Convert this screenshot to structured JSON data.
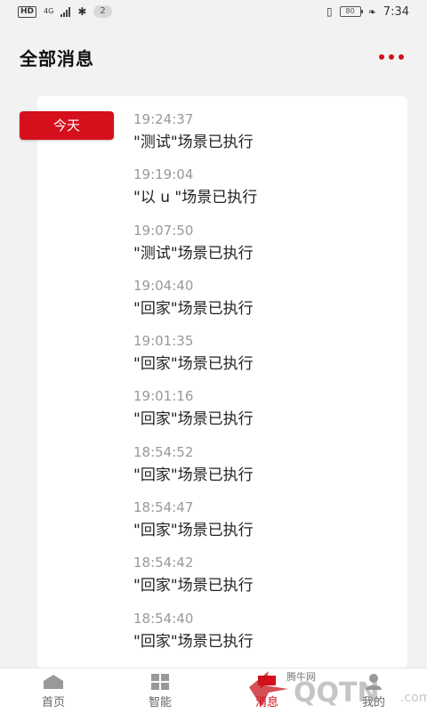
{
  "status_bar": {
    "hd": "HD",
    "network": "4G",
    "notification_count": "2",
    "battery": "80",
    "time": "7:34"
  },
  "header": {
    "title": "全部消息"
  },
  "date_tag": "今天",
  "messages": [
    {
      "time": "19:24:37",
      "text": "\"测试\"场景已执行"
    },
    {
      "time": "19:19:04",
      "text": "\"以 u \"场景已执行"
    },
    {
      "time": "19:07:50",
      "text": "\"测试\"场景已执行"
    },
    {
      "time": "19:04:40",
      "text": "\"回家\"场景已执行"
    },
    {
      "time": "19:01:35",
      "text": "\"回家\"场景已执行"
    },
    {
      "time": "19:01:16",
      "text": "\"回家\"场景已执行"
    },
    {
      "time": "18:54:52",
      "text": "\"回家\"场景已执行"
    },
    {
      "time": "18:54:47",
      "text": "\"回家\"场景已执行"
    },
    {
      "time": "18:54:42",
      "text": "\"回家\"场景已执行"
    },
    {
      "time": "18:54:40",
      "text": "\"回家\"场景已执行"
    }
  ],
  "tabs": [
    {
      "label": "首页",
      "icon": "home-icon"
    },
    {
      "label": "智能",
      "icon": "grid-icon"
    },
    {
      "label": "消息",
      "icon": "message-icon"
    },
    {
      "label": "我的",
      "icon": "user-icon"
    }
  ],
  "watermark": "腾牛网",
  "colors": {
    "accent": "#d50f1c",
    "background": "#f2f2f2",
    "card": "#ffffff",
    "time_text": "#999999"
  }
}
